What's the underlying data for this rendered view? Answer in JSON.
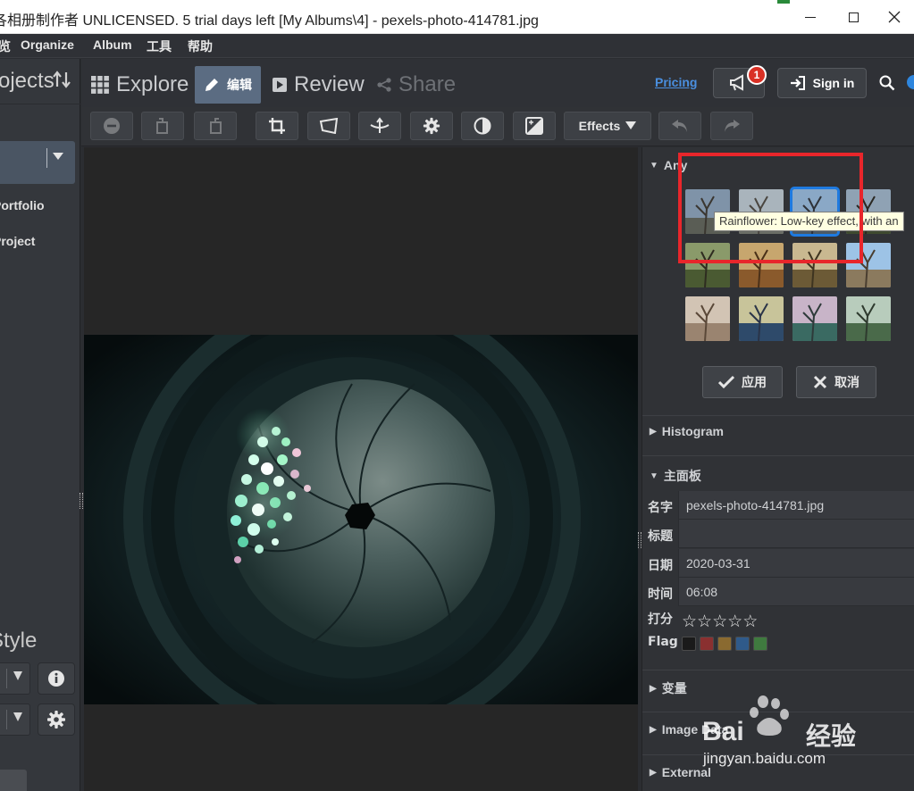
{
  "window": {
    "title": "各相册制作者 UNLICENSED. 5 trial days left [My Albums\\4] - pexels-photo-414781.jpg",
    "minimize": "—",
    "maximize": "☐",
    "close": "✕"
  },
  "menu": [
    {
      "label": "览"
    },
    {
      "label": "Organize"
    },
    {
      "label": "Album"
    },
    {
      "label": "工具"
    },
    {
      "label": "帮助"
    }
  ],
  "left_panel": {
    "title": "Projects",
    "items": [
      "Portfolio",
      "Project"
    ],
    "style_label": "Style"
  },
  "tabs": {
    "explore": "Explore",
    "edit": "编辑",
    "review": "Review",
    "share": "Share"
  },
  "header": {
    "pricing": "Pricing",
    "notification_count": "1",
    "sign_in": "Sign in"
  },
  "toolbar": {
    "effects_label": "Effects"
  },
  "effects_panel": {
    "section_title": "Any",
    "tooltip": "Rainflower: Low-key effect, with an",
    "apply_label": "应用",
    "cancel_label": "取消"
  },
  "sections": {
    "histogram": "Histogram",
    "main_panel": "主面板",
    "variables": "变量",
    "image_data": "Image Data",
    "external": "External"
  },
  "metadata": {
    "name_key": "名字",
    "name_val": "pexels-photo-414781.jpg",
    "title_key": "标题",
    "title_val": "",
    "date_key": "日期",
    "date_val": "2020-03-31",
    "time_key": "时间",
    "time_val": "06:08",
    "rating_key": "打分",
    "rating_value": 0,
    "rating_max": 5,
    "flag_key": "Flag",
    "flag_colors": [
      "#1a1a1a",
      "#8a3030",
      "#8a6a30",
      "#2f5a8a",
      "#3f7a3f"
    ]
  },
  "watermark": {
    "brand": "Bai",
    "brand_cn": "经验",
    "url": "jingyan.baidu.com"
  },
  "colors": {
    "accent_blue": "#1e7ae0",
    "highlight_red": "#e8262b",
    "badge_red": "#d93025",
    "pricing_link": "#4a8fe0"
  }
}
